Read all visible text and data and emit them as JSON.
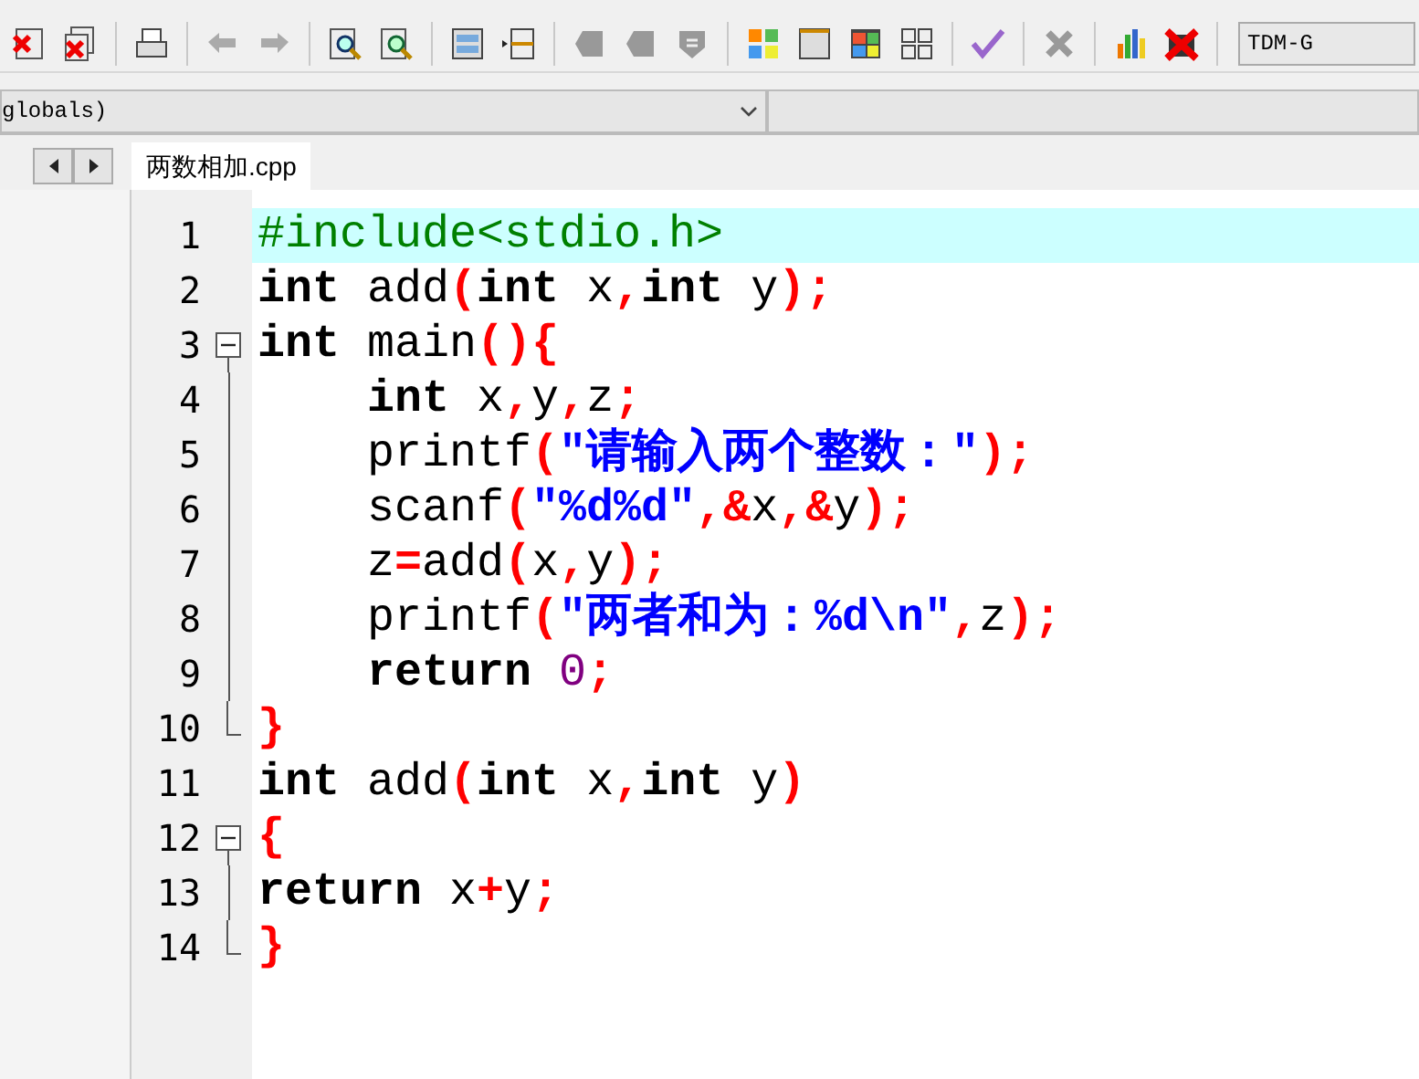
{
  "scope_combo": {
    "value": "globals)"
  },
  "compiler_combo": {
    "value": "TDM-G"
  },
  "tabs": [
    {
      "label": "两数相加.cpp",
      "selected": true
    }
  ],
  "editor": {
    "lines": [
      {
        "number": "1",
        "current": true,
        "kind": "plain",
        "indented": false,
        "tokens": [
          {
            "kind": "pre",
            "text": "#include<stdio.h>"
          }
        ]
      },
      {
        "number": "2",
        "current": false,
        "kind": "plain",
        "indented": false,
        "tokens": [
          {
            "kind": "kw",
            "text": "int"
          },
          {
            "kind": "id",
            "text": " add"
          },
          {
            "kind": "sym",
            "text": "("
          },
          {
            "kind": "kw",
            "text": "int"
          },
          {
            "kind": "id",
            "text": " x"
          },
          {
            "kind": "sym",
            "text": ","
          },
          {
            "kind": "kw",
            "text": "int"
          },
          {
            "kind": "id",
            "text": " y"
          },
          {
            "kind": "sym",
            "text": ");"
          }
        ]
      },
      {
        "number": "3",
        "current": false,
        "kind": "fold_start",
        "indented": false,
        "tokens": [
          {
            "kind": "kw",
            "text": "int"
          },
          {
            "kind": "id",
            "text": " main"
          },
          {
            "kind": "sym",
            "text": "(){"
          }
        ]
      },
      {
        "number": "4",
        "current": false,
        "kind": "fold_body",
        "indented": true,
        "tokens": [
          {
            "kind": "kw",
            "text": "int"
          },
          {
            "kind": "id",
            "text": " x"
          },
          {
            "kind": "sym",
            "text": ","
          },
          {
            "kind": "id",
            "text": "y"
          },
          {
            "kind": "sym",
            "text": ","
          },
          {
            "kind": "id",
            "text": "z"
          },
          {
            "kind": "sym",
            "text": ";"
          }
        ]
      },
      {
        "number": "5",
        "current": false,
        "kind": "fold_body",
        "indented": true,
        "tokens": [
          {
            "kind": "id",
            "text": "printf"
          },
          {
            "kind": "sym",
            "text": "("
          },
          {
            "kind": "str",
            "text": "\"请输入两个整数：\""
          },
          {
            "kind": "sym",
            "text": ");"
          }
        ]
      },
      {
        "number": "6",
        "current": false,
        "kind": "fold_body",
        "indented": true,
        "tokens": [
          {
            "kind": "id",
            "text": "scanf"
          },
          {
            "kind": "sym",
            "text": "("
          },
          {
            "kind": "str",
            "text": "\"%d%d\""
          },
          {
            "kind": "sym",
            "text": ",&"
          },
          {
            "kind": "id",
            "text": "x"
          },
          {
            "kind": "sym",
            "text": ",&"
          },
          {
            "kind": "id",
            "text": "y"
          },
          {
            "kind": "sym",
            "text": ");"
          }
        ]
      },
      {
        "number": "7",
        "current": false,
        "kind": "fold_body",
        "indented": true,
        "tokens": [
          {
            "kind": "id",
            "text": "z"
          },
          {
            "kind": "sym",
            "text": "="
          },
          {
            "kind": "id",
            "text": "add"
          },
          {
            "kind": "sym",
            "text": "("
          },
          {
            "kind": "id",
            "text": "x"
          },
          {
            "kind": "sym",
            "text": ","
          },
          {
            "kind": "id",
            "text": "y"
          },
          {
            "kind": "sym",
            "text": ");"
          }
        ]
      },
      {
        "number": "8",
        "current": false,
        "kind": "fold_body",
        "indented": true,
        "tokens": [
          {
            "kind": "id",
            "text": "printf"
          },
          {
            "kind": "sym",
            "text": "("
          },
          {
            "kind": "str",
            "text": "\"两者和为：%d\\n\""
          },
          {
            "kind": "sym",
            "text": ","
          },
          {
            "kind": "id",
            "text": "z"
          },
          {
            "kind": "sym",
            "text": ");"
          }
        ]
      },
      {
        "number": "9",
        "current": false,
        "kind": "fold_body",
        "indented": true,
        "tokens": [
          {
            "kind": "kw",
            "text": "return "
          },
          {
            "kind": "num",
            "text": "0"
          },
          {
            "kind": "sym",
            "text": ";"
          }
        ]
      },
      {
        "number": "10",
        "current": false,
        "kind": "fold_end",
        "indented": false,
        "tokens": [
          {
            "kind": "sym",
            "text": "}"
          }
        ]
      },
      {
        "number": "11",
        "current": false,
        "kind": "plain",
        "indented": false,
        "tokens": [
          {
            "kind": "kw",
            "text": "int"
          },
          {
            "kind": "id",
            "text": " add"
          },
          {
            "kind": "sym",
            "text": "("
          },
          {
            "kind": "kw",
            "text": "int"
          },
          {
            "kind": "id",
            "text": " x"
          },
          {
            "kind": "sym",
            "text": ","
          },
          {
            "kind": "kw",
            "text": "int"
          },
          {
            "kind": "id",
            "text": " y"
          },
          {
            "kind": "sym",
            "text": ")"
          }
        ]
      },
      {
        "number": "12",
        "current": false,
        "kind": "fold_start",
        "indented": false,
        "tokens": [
          {
            "kind": "sym",
            "text": "{"
          }
        ]
      },
      {
        "number": "13",
        "current": false,
        "kind": "fold_body",
        "indented": false,
        "tokens": [
          {
            "kind": "kw",
            "text": "return"
          },
          {
            "kind": "id",
            "text": " x"
          },
          {
            "kind": "sym",
            "text": "+"
          },
          {
            "kind": "id",
            "text": "y"
          },
          {
            "kind": "sym",
            "text": ";"
          }
        ]
      },
      {
        "number": "14",
        "current": false,
        "kind": "fold_end",
        "indented": false,
        "tokens": [
          {
            "kind": "sym",
            "text": "}"
          }
        ]
      }
    ]
  }
}
